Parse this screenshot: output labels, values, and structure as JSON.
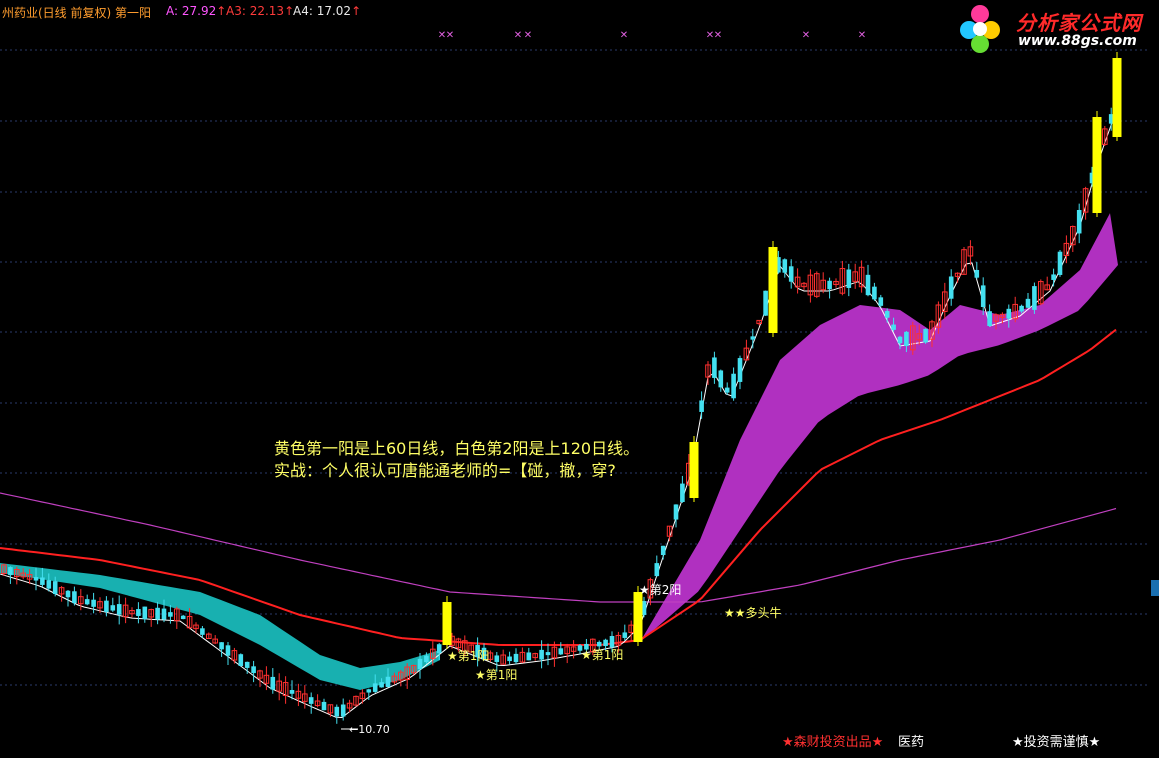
{
  "header": {
    "title": "州药业(日线 前复权) 第一阳",
    "a_label": "A: 27.92",
    "a3_label": "A3: 22.13",
    "a4_label": "A4: 17.02",
    "arrow": "↑"
  },
  "logo": {
    "text": "分析家公式网",
    "url": "www.88gs.com"
  },
  "note": {
    "line1": "黄色第一阳是上60日线，白色第2阳是上120日线。",
    "line2": "实战：个人很认可唐能通老师的=【碰，撤，穿?"
  },
  "footer": {
    "item1": "★森财投资出品★",
    "item2": "医药",
    "item3": "★投资需谨慎★"
  },
  "chart_data": {
    "type": "candlestick",
    "low_label": "10.70",
    "grid": "horizontal dashed",
    "colors": {
      "up": "#ff3030",
      "down": "#44e0f0",
      "signal": "#ffff00",
      "band": "#b030c0",
      "band_teal": "#18b0b0",
      "ma_red": "#ff2020",
      "ma_purple": "#c040c0",
      "ma_white": "#ffffff",
      "marker": "#e060e0"
    },
    "annotations": [
      "★第1阳",
      "★第1阳",
      "★第1阳",
      "★第2阳",
      "★★多头牛"
    ],
    "top_marker_char": "✕"
  }
}
